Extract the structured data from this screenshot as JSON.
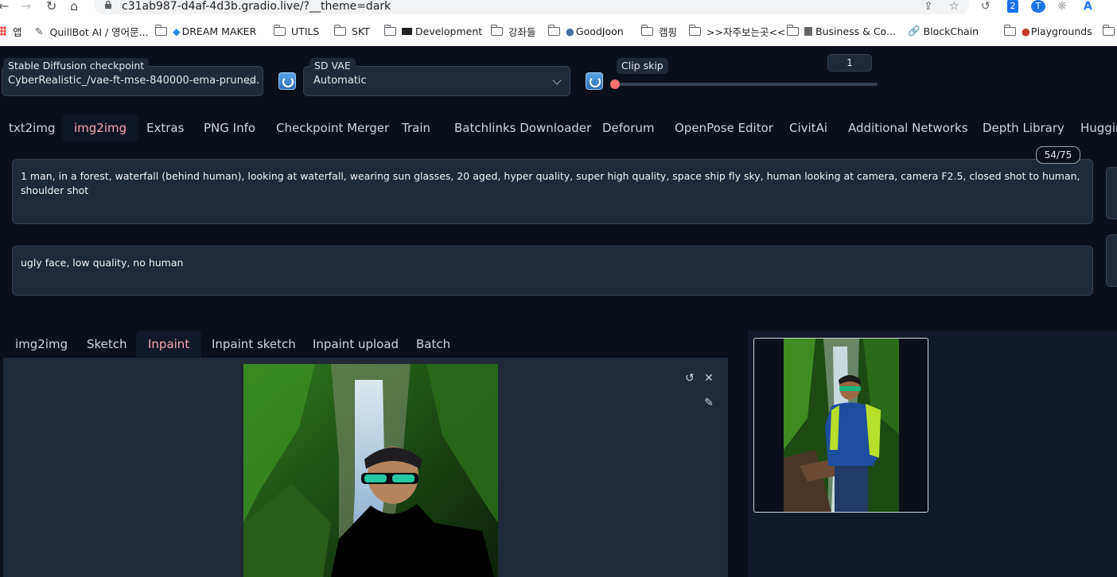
{
  "browser": {
    "url": "c31ab987-d4af-4d3b.gradio.live/?__theme=dark",
    "bookmarks": [
      "앱",
      "QuillBot AI / 영어문...",
      "DREAM MAKER",
      "UTILS",
      "SKT",
      "Development",
      "강좌들",
      "GoodJoon",
      "캠핑",
      ">>자주보는곳<<",
      "Business & Co...",
      "BlockChain",
      "Playgrounds"
    ]
  },
  "settings": {
    "checkpoint_label": "Stable Diffusion checkpoint",
    "checkpoint_value": "CyberRealistic_/vae-ft-mse-840000-ema-pruned.",
    "vae_label": "SD VAE",
    "vae_value": "Automatic",
    "clip_label": "Clip skip",
    "clip_value": "1"
  },
  "tabs": [
    "txt2img",
    "img2img",
    "Extras",
    "PNG Info",
    "Checkpoint Merger",
    "Train",
    "Batchlinks Downloader",
    "Deforum",
    "OpenPose Editor",
    "CivitAi",
    "Additional Networks",
    "Depth Library",
    "Huggin"
  ],
  "active_tab": "img2img",
  "prompt": {
    "positive": "1 man, in a forest, waterfall (behind human), looking at waterfall, wearing sun glasses, 20 aged, hyper quality, super high quality, space ship fly sky, human looking at camera, camera F2.5, closed shot to human, shoulder shot",
    "negative": "ugly face, low quality, no human",
    "token_counter": "54/75"
  },
  "subtabs": [
    "img2img",
    "Sketch",
    "Inpaint",
    "Inpaint sketch",
    "Inpaint upload",
    "Batch"
  ],
  "active_subtab": "Inpaint",
  "colors": {
    "accent": "#f8a7ad",
    "bg": "#0b0f19",
    "panel": "#1f2937"
  }
}
